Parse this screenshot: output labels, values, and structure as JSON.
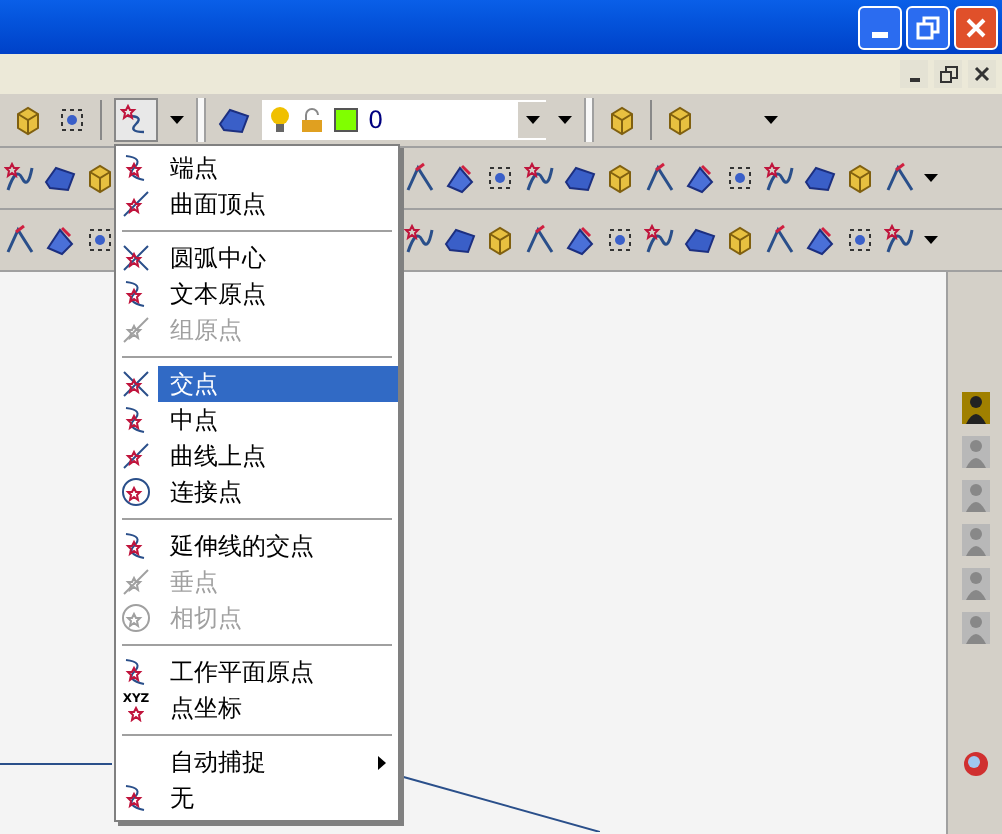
{
  "layer_toolbar": {
    "value": "0",
    "color": "#80ff00"
  },
  "snap_menu": {
    "items": [
      {
        "kind": "item",
        "label": "端点",
        "selected": false,
        "disabled": false
      },
      {
        "kind": "item",
        "label": "曲面顶点",
        "selected": false,
        "disabled": false
      },
      {
        "kind": "separator"
      },
      {
        "kind": "item",
        "label": "圆弧中心",
        "selected": false,
        "disabled": false
      },
      {
        "kind": "item",
        "label": "文本原点",
        "selected": false,
        "disabled": false
      },
      {
        "kind": "item",
        "label": "组原点",
        "selected": false,
        "disabled": true
      },
      {
        "kind": "separator"
      },
      {
        "kind": "item",
        "label": "交点",
        "selected": true,
        "disabled": false
      },
      {
        "kind": "item",
        "label": "中点",
        "selected": false,
        "disabled": false
      },
      {
        "kind": "item",
        "label": "曲线上点",
        "selected": false,
        "disabled": false
      },
      {
        "kind": "item",
        "label": "连接点",
        "selected": false,
        "disabled": false
      },
      {
        "kind": "separator"
      },
      {
        "kind": "item",
        "label": "延伸线的交点",
        "selected": false,
        "disabled": false
      },
      {
        "kind": "item",
        "label": "垂点",
        "selected": false,
        "disabled": true
      },
      {
        "kind": "item",
        "label": "相切点",
        "selected": false,
        "disabled": true
      },
      {
        "kind": "separator"
      },
      {
        "kind": "item",
        "label": "工作平面原点",
        "selected": false,
        "disabled": false
      },
      {
        "kind": "item",
        "label": "点坐标",
        "selected": false,
        "disabled": false,
        "icon_label": "XYZ"
      },
      {
        "kind": "separator"
      },
      {
        "kind": "submenu",
        "label": "自动捕捉",
        "selected": false,
        "disabled": false
      },
      {
        "kind": "item",
        "label": "无",
        "selected": false,
        "disabled": false
      }
    ]
  }
}
